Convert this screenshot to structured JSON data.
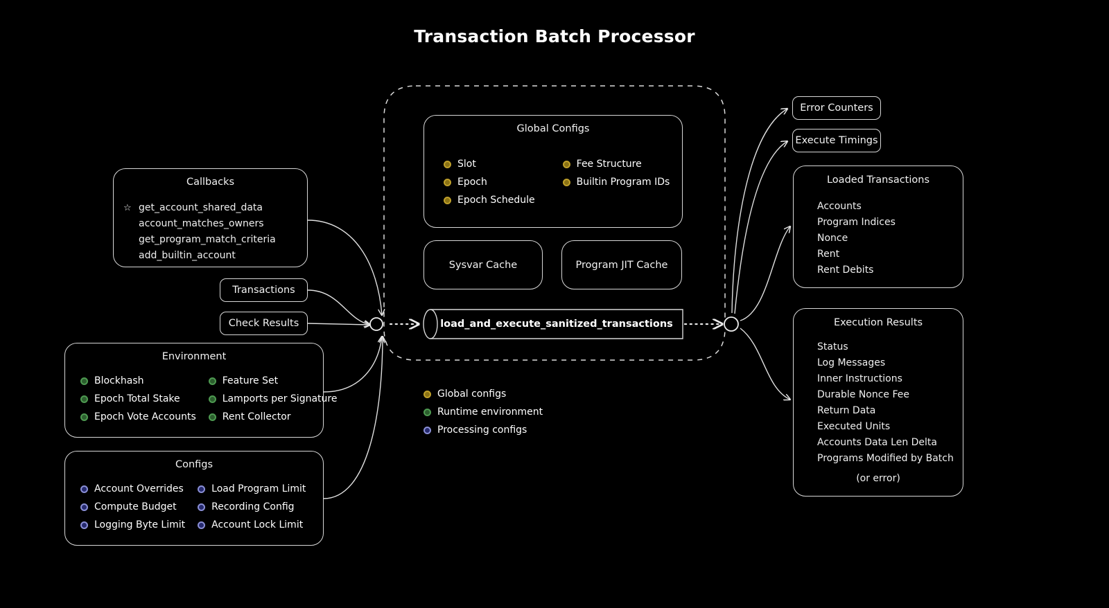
{
  "title": "Transaction Batch Processor",
  "colors": {
    "background": "#000000",
    "stroke": "#d8d8d8",
    "text": "#ffffff",
    "global_configs_bullet": "#bfa02a",
    "runtime_environment_bullet": "#4e9a51",
    "processing_configs_bullet": "#8a8fd6"
  },
  "callbacks": {
    "title": "Callbacks",
    "star_icon": "star-icon",
    "items": [
      "get_account_shared_data",
      "account_matches_owners",
      "get_program_match_criteria",
      "add_builtin_account"
    ]
  },
  "transactions_box": {
    "label": "Transactions"
  },
  "check_results_box": {
    "label": "Check Results"
  },
  "environment": {
    "title": "Environment",
    "bullet_color": "green",
    "items": [
      "Blockhash",
      "Feature Set",
      "Epoch Total Stake",
      "Lamports per Signature",
      "Epoch Vote Accounts",
      "Rent Collector"
    ]
  },
  "configs": {
    "title": "Configs",
    "bullet_color": "indigo",
    "items": [
      "Account Overrides",
      "Load Program Limit",
      "Compute Budget",
      "Recording Config",
      "Logging Byte Limit",
      "Account Lock Limit"
    ]
  },
  "global_configs": {
    "title": "Global Configs",
    "bullet_color": "gold",
    "items": [
      "Slot",
      "Fee Structure",
      "Epoch",
      "Builtin Program IDs",
      "Epoch Schedule"
    ]
  },
  "sysvar_cache": {
    "label": "Sysvar Cache"
  },
  "program_jit_cache": {
    "label": "Program JIT Cache"
  },
  "main_function": {
    "label": "load_and_execute_sanitized_transactions"
  },
  "legend": {
    "items": [
      {
        "label": "Global configs",
        "color": "gold"
      },
      {
        "label": "Runtime environment",
        "color": "green"
      },
      {
        "label": "Processing configs",
        "color": "indigo"
      }
    ]
  },
  "error_counters": {
    "label": "Error Counters"
  },
  "execute_timings": {
    "label": "Execute Timings"
  },
  "loaded_transactions": {
    "title": "Loaded Transactions",
    "items": [
      "Accounts",
      "Program Indices",
      "Nonce",
      "Rent",
      "Rent Debits"
    ]
  },
  "execution_results": {
    "title": "Execution Results",
    "items": [
      "Status",
      "Log Messages",
      "Inner Instructions",
      "Durable Nonce Fee",
      "Return Data",
      "Executed Units",
      "Accounts Data Len Delta",
      "Programs Modified by Batch"
    ],
    "footnote": "(or error)"
  }
}
